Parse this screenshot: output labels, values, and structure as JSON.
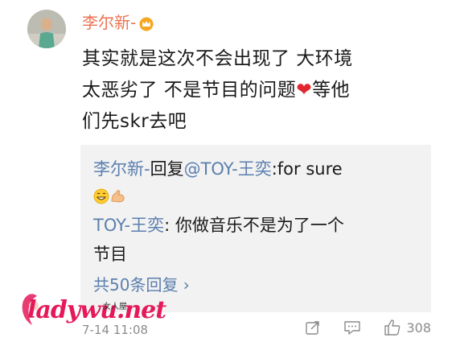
{
  "user": {
    "name": "李尔新-",
    "vip_icon": "crown-icon"
  },
  "post": {
    "lines": [
      "其实就是这次不会出现了 大环境",
      "太恶劣了 不是节目的问题",
      "等他",
      "们先skr去吧"
    ],
    "heart_icon": "heart-icon"
  },
  "replies": [
    {
      "author": "李尔新-",
      "reply_word": "回复",
      "target": "@TOY-王奕",
      "text": ":for sure",
      "emoji_icons": [
        "grin-emoji-icon",
        "flexed-arm-emoji-icon"
      ]
    },
    {
      "author": "TOY-王奕",
      "separator": ": ",
      "text_line1": "你做音乐不是为了一个",
      "text_line2": "节目"
    }
  ],
  "more_replies_label": "共50条回复 ›",
  "watermark": {
    "latin": "ladywu.net",
    "chinese": "女人屋"
  },
  "timestamp": "7-14 11:08",
  "actions": {
    "like_count": "308"
  },
  "colors": {
    "username": "#eb7350",
    "link": "#5b7fae",
    "heart": "#e2262f",
    "reply_bg": "#f2f2f2",
    "meta": "#8c8c8c"
  }
}
